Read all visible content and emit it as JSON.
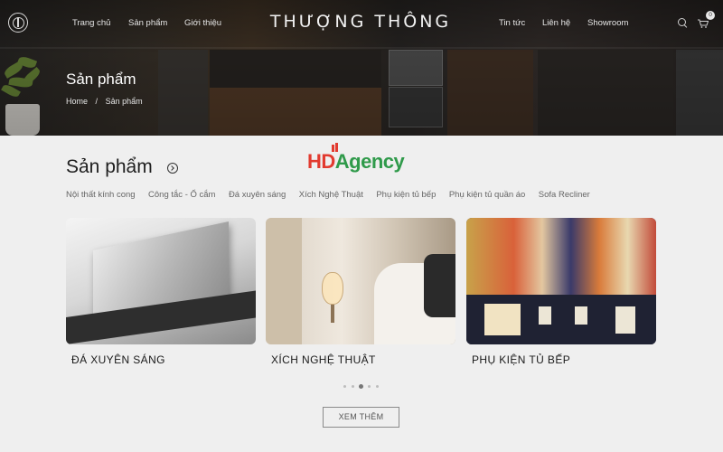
{
  "nav": {
    "left_items": [
      "Trang chủ",
      "Sản phẩm",
      "Giới thiệu"
    ],
    "brand": "THƯỢNG THÔNG",
    "right_items": [
      "Tin tức",
      "Liên hệ",
      "Showroom"
    ],
    "cart_count": "0"
  },
  "hero": {
    "title": "Sản phẩm",
    "breadcrumb": [
      "Home",
      "/",
      "Sản phẩm"
    ]
  },
  "section": {
    "title": "Sản phẩm",
    "categories": [
      "Nội thất kính cong",
      "Công tắc - Ổ cắm",
      "Đá xuyên sáng",
      "Xích Nghệ Thuật",
      "Phụ kiện tủ bếp",
      "Phụ kiện tủ quần áo",
      "Sofa Recliner"
    ]
  },
  "watermark": {
    "hd": "HD",
    "agency": "Agency"
  },
  "cards": [
    {
      "label": "ĐÁ XUYÊN SÁNG"
    },
    {
      "label": "XÍCH NGHỆ THUẬT"
    },
    {
      "label": "PHỤ KIỆN TỦ BẾP"
    }
  ],
  "carousel": {
    "total": 5,
    "active": 3
  },
  "more_button": "XEM THÊM",
  "icons": {
    "search": "search-icon",
    "cart": "cart-icon",
    "logo": "logo-icon",
    "arrow": "arrow-right-circle-icon"
  },
  "colors": {
    "hd_red": "#e23a2f",
    "agency_green": "#2f9a4a"
  }
}
